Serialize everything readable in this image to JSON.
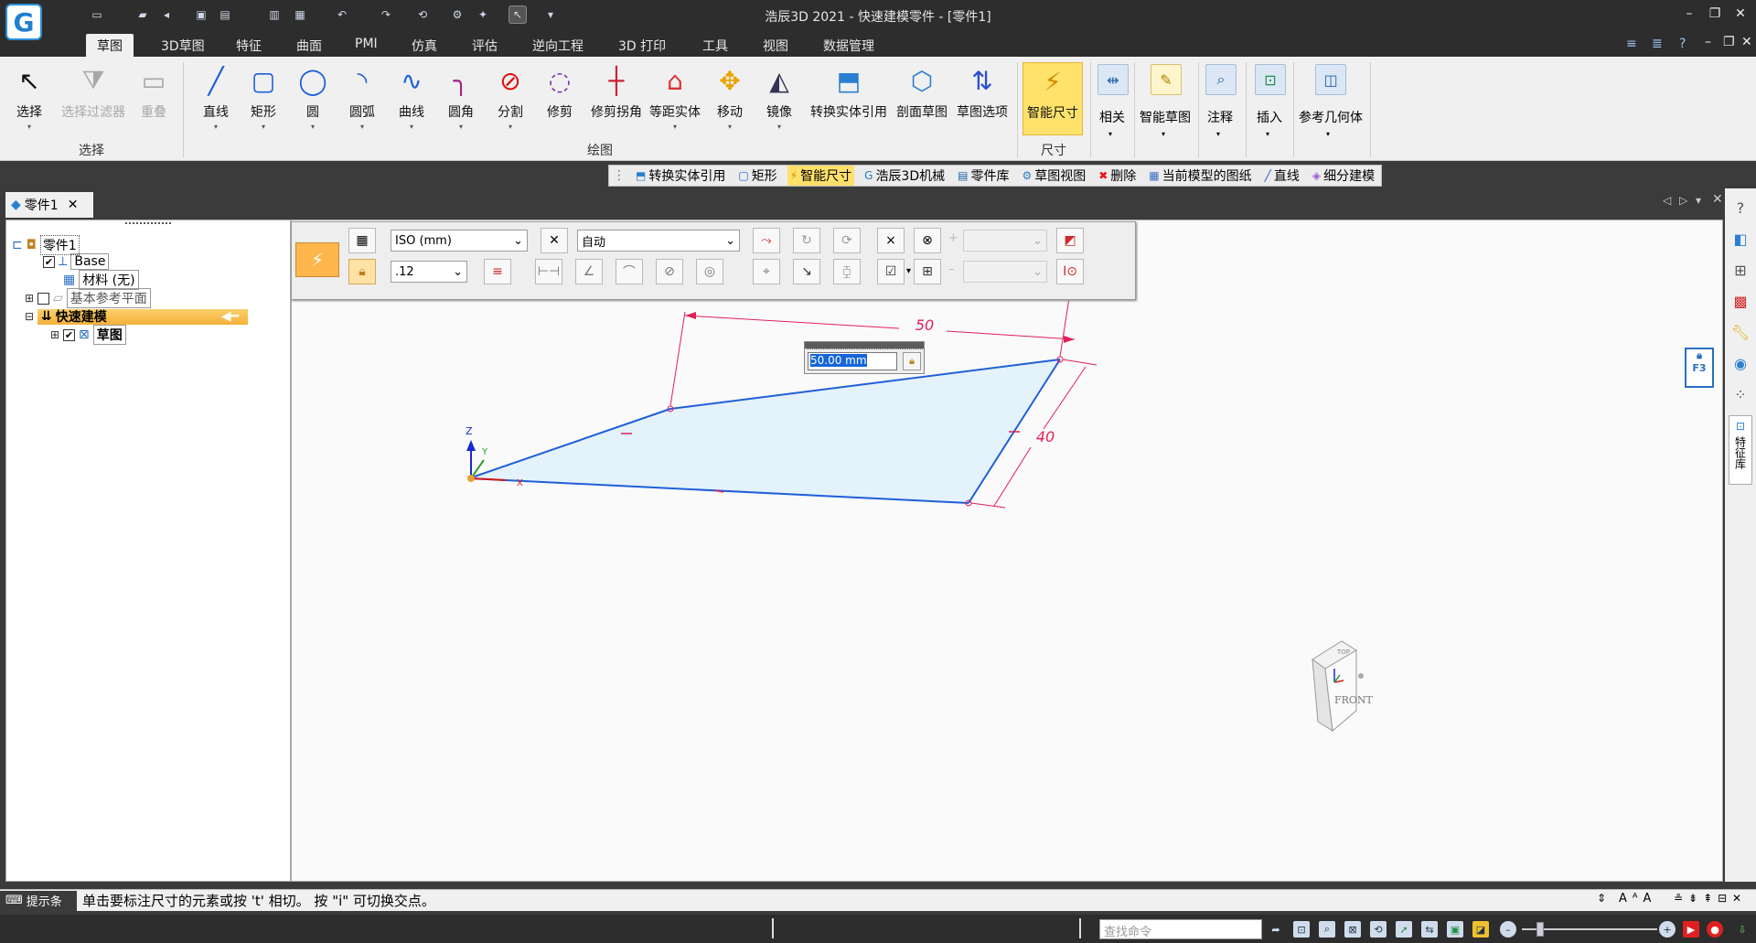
{
  "app": {
    "title": "浩辰3D 2021 - 快速建模零件 - [零件1]",
    "logo_letter": "G"
  },
  "tabs": [
    "草图",
    "3D草图",
    "特征",
    "曲面",
    "PMI",
    "仿真",
    "评估",
    "逆向工程",
    "3D 打印",
    "工具",
    "视图",
    "数据管理"
  ],
  "ribbon": {
    "select_group": {
      "label": "选择",
      "buttons": [
        "选择",
        "选择过滤器",
        "重叠"
      ]
    },
    "draw_group": {
      "label": "绘图",
      "buttons": [
        "直线",
        "矩形",
        "圆",
        "圆弧",
        "曲线",
        "圆角",
        "分割",
        "修剪",
        "修剪拐角",
        "等距实体",
        "移动",
        "镜像",
        "转换实体引用",
        "剖面草图",
        "草图选项"
      ]
    },
    "dim_group": {
      "label": "尺寸",
      "buttons": [
        "智能尺寸"
      ]
    },
    "other_buttons": [
      "相关",
      "智能草图",
      "注释",
      "插入",
      "参考几何体"
    ]
  },
  "cmdstrip": [
    "转换实体引用",
    "矩形",
    "智能尺寸",
    "浩辰3D机械",
    "零件库",
    "草图视图",
    "删除",
    "当前模型的图纸",
    "直线",
    "细分建模"
  ],
  "doc_tab": {
    "label": "零件1"
  },
  "tree": {
    "root": "零件1",
    "base": "Base",
    "material": "材料 (无)",
    "ref_planes": "基本参考平面",
    "quick_model": "快速建模",
    "sketch": "草图"
  },
  "dim_toolbar": {
    "standard": "ISO (mm)",
    "precision": ".12",
    "mode": "自动"
  },
  "dims": {
    "width": "50",
    "height": "40",
    "edit_value": "50.00 mm"
  },
  "axes": {
    "z": "Z",
    "y": "Y",
    "x": "X"
  },
  "viewcube": {
    "top": "TOP",
    "front": "FRONT"
  },
  "sidebar": {
    "lock_key": "F3",
    "feature_lib": "特征库"
  },
  "status": {
    "label": "提示条",
    "message": "单击要标注尺寸的元素或按 't' 相切。 按 \"i\" 可切换交点。"
  },
  "find_command_placeholder": "查找命令",
  "colors": {
    "accent": "#ffe26b",
    "sketch_line": "#1f5fd8",
    "dimension": "#e0205a",
    "sketch_fill": "#e4f2fb",
    "tree_highlight": "#f5b13a"
  }
}
